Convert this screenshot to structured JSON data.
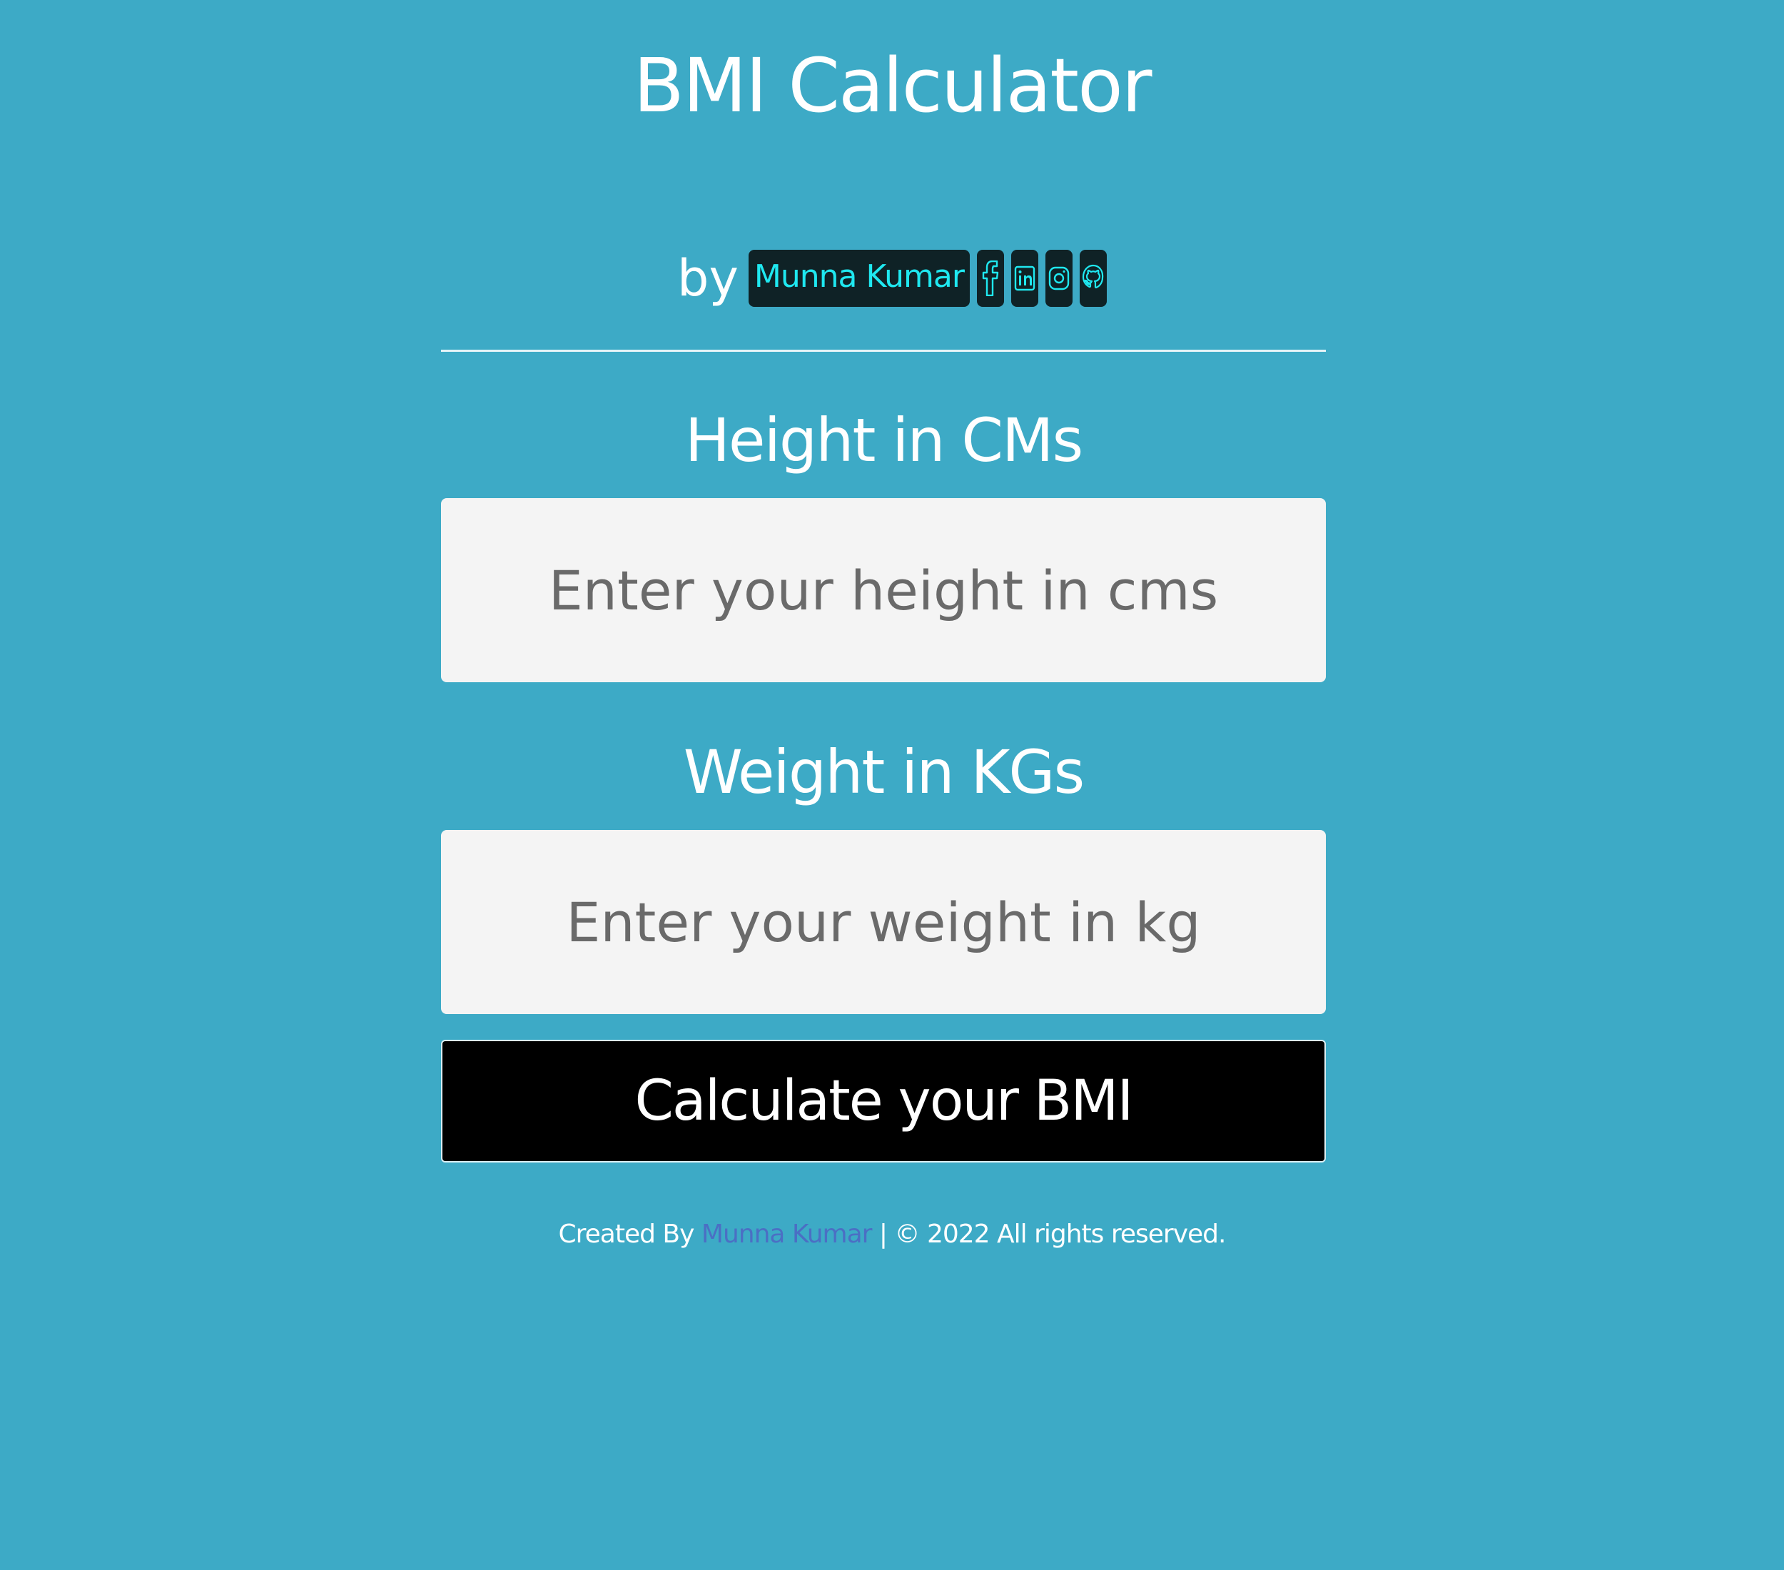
{
  "header": {
    "title": "BMI Calculator",
    "by": "by",
    "author": "Munna Kumar",
    "social": [
      "facebook-icon",
      "linkedin-icon",
      "instagram-icon",
      "github-icon"
    ]
  },
  "form": {
    "height_label": "Height in CMs",
    "height_placeholder": "Enter your height in cms",
    "weight_label": "Weight in KGs",
    "weight_placeholder": "Enter your weight in kg",
    "submit_label": "Calculate your BMI"
  },
  "footer": {
    "created_by": "Created By",
    "author": "Munna Kumar",
    "copyright": "| © 2022 All rights reserved."
  },
  "colors": {
    "background": "#3daac6",
    "badge_bg": "#0f2226",
    "badge_text": "#1fe8f0",
    "input_bg": "#f4f4f4",
    "button_bg": "#000000",
    "footer_link": "#4b6fc4"
  }
}
